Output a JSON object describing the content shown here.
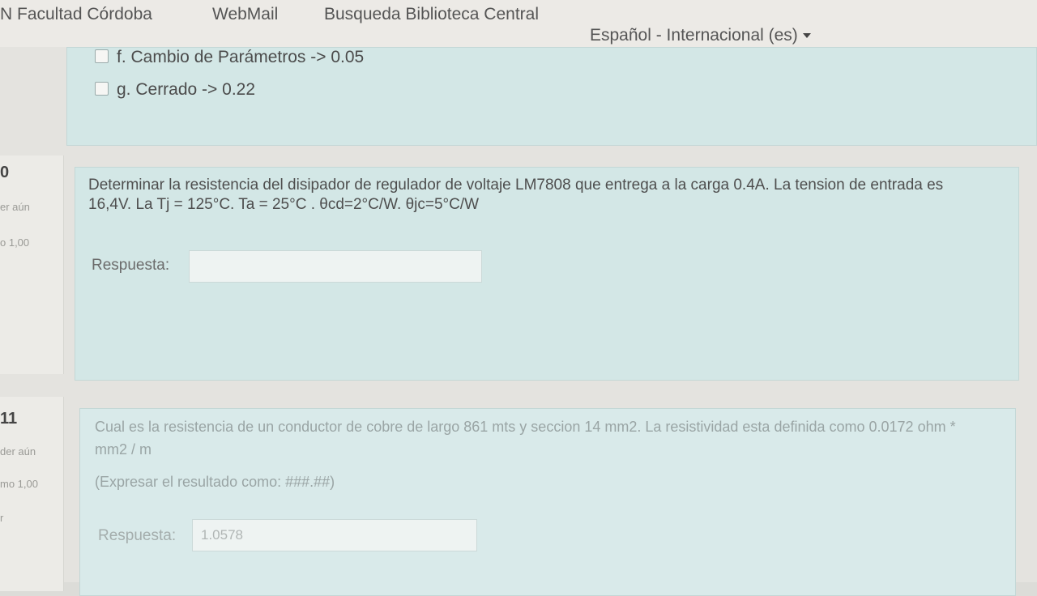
{
  "nav": {
    "site": "N Facultad Córdoba",
    "webmail": "WebMail",
    "library": "Busqueda Biblioteca Central",
    "language": "Español - Internacional (es)"
  },
  "prev_question": {
    "options": [
      {
        "label": "f. Cambio de Parámetros -> 0.05"
      },
      {
        "label": "g. Cerrado -> 0.22"
      }
    ]
  },
  "q10": {
    "number": "0",
    "state": "er aún",
    "grade": "o 1,00",
    "text": "Determinar la resistencia del disipador de regulador de voltaje LM7808 que entrega a la carga 0.4A. La tension de entrada es 16,4V. La Tj = 125°C. Ta = 25°C . θcd=2°C/W. θjc=5°C/W",
    "answer_label": "Respuesta:",
    "answer_value": ""
  },
  "q11": {
    "number": "11",
    "state": "der aún",
    "grade": "mo 1,00",
    "flag": "r",
    "text": "Cual es la resistencia de un conductor de cobre de largo 861 mts y seccion 14 mm2. La resistividad esta definida como 0.0172 ohm * mm2 / m",
    "hint": "(Expresar el resultado como: ###.##)",
    "answer_label": "Respuesta:",
    "answer_value": "1.0578"
  }
}
